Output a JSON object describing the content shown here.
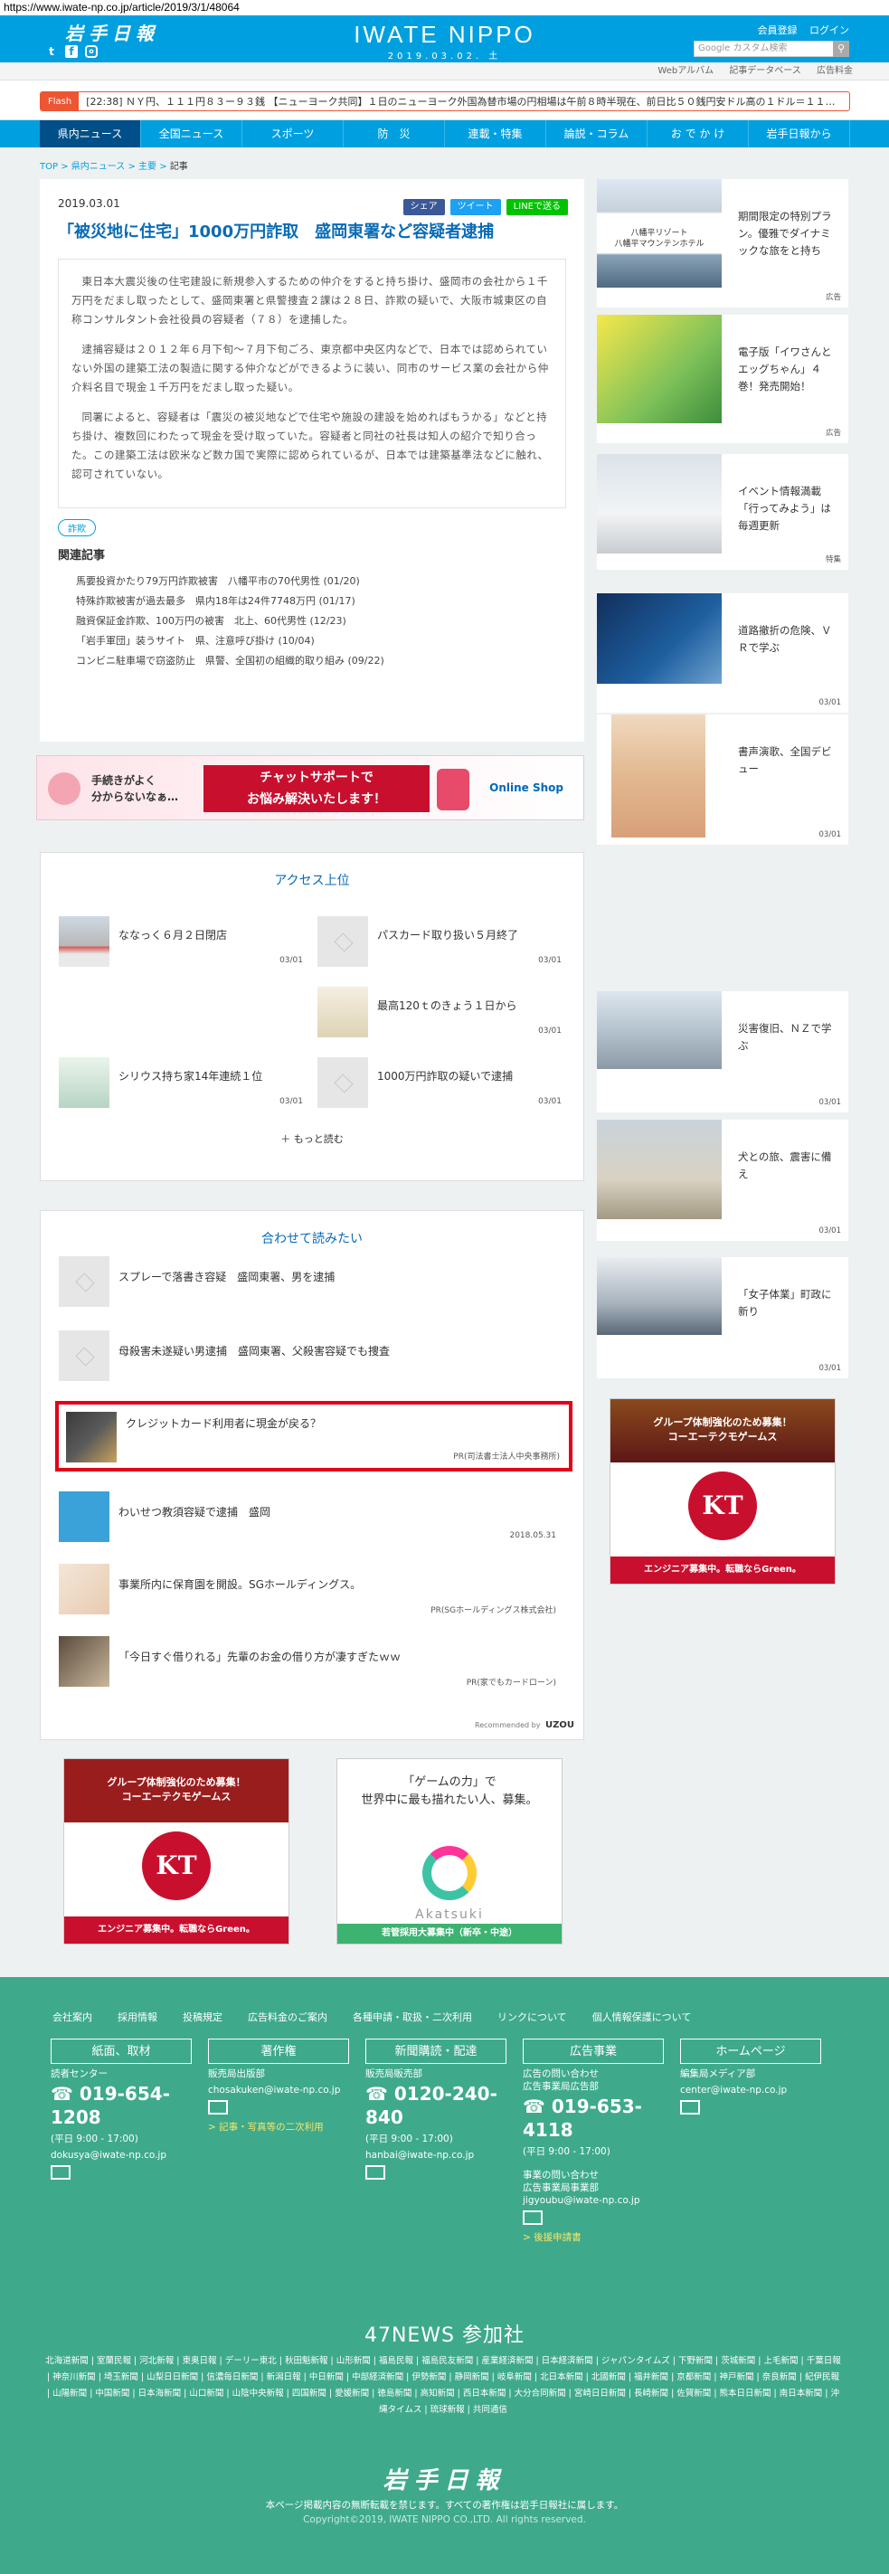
{
  "url": "https://www.iwate-np.co.jp/article/2019/3/1/48064",
  "header": {
    "logo_jp": "岩手日報",
    "brand": "IWATE NIPPO",
    "date": "2019.03.02. 土",
    "register": "会員登録",
    "login": "ログイン",
    "search_placeholder": "Google カスタム検索",
    "social_icons": [
      "twitter-icon",
      "facebook-icon",
      "instagram-icon"
    ]
  },
  "subnav": [
    "Webアルバム",
    "記事データベース",
    "広告料金"
  ],
  "flash": {
    "label": "Flash",
    "text": "[22:38] ＮＹ円、１１１円８３ー９３銭 【ニューヨーク共同】１日のニューヨーク外国為替市場の円相場は午前８時半現在、前日比５０銭円安ドル高の１ドル＝１１…"
  },
  "mainnav": [
    "県内ニュース",
    "全国ニュース",
    "スポーツ",
    "防　災",
    "連載・特集",
    "論説・コラム",
    "お で か け",
    "岩手日報から"
  ],
  "breadcrumb": {
    "top": "TOP",
    "sep": ">",
    "c1": "県内ニュース",
    "c2": "主要",
    "c3": "記事"
  },
  "article": {
    "date": "2019.03.01",
    "share_fb": "シェア",
    "share_tw": "ツイート",
    "share_line": "LINEで送る",
    "title": "「被災地に住宅」1000万円詐取　盛岡東署など容疑者逮捕",
    "paragraphs": [
      "東日本大震災後の住宅建設に新規参入するための仲介をすると持ち掛け、盛岡市の会社から１千万円をだまし取ったとして、盛岡東署と県警捜査２課は２８日、詐欺の疑いで、大阪市城東区の自称コンサルタント会社役員の容疑者（７８）を逮捕した。",
      "逮捕容疑は２０１２年６月下旬～７月下旬ごろ、東京都中央区内などで、日本では認められていない外国の建築工法の製造に関する仲介などができるように装い、同市のサービス業の会社から仲介料名目で現金１千万円をだまし取った疑い。",
      "同署によると、容疑者は「震災の被災地などで住宅や施設の建設を始めればもうかる」などと持ち掛け、複数回にわたって現金を受け取っていた。容疑者と同社の社長は知人の紹介で知り合った。この建築工法は欧米など数カ国で実際に認められているが、日本では建築基準法などに触れ、認可されていない。"
    ],
    "tag": "詐欺",
    "related_title": "関連記事",
    "related": [
      "馬要投資かたり79万円詐欺被害　八幡平市の70代男性 (01/20)",
      "特殊詐欺被害が過去最多　県内18年は24件7748万円 (01/17)",
      "融資保証金詐欺、100万円の被害　北上、60代男性 (12/23)",
      "「岩手軍団」装うサイト　県、注意呼び掛け (10/04)",
      "コンビニ駐車場で窃盗防止　県警、全国初の組織的取り組み (09/22)"
    ]
  },
  "ad_banner": {
    "left": "手続きがよく\n分からないなぁ…",
    "center": "チャットサポートで\nお悩み解決いたします！",
    "right": "Online Shop"
  },
  "access": {
    "title": "アクセス上位",
    "items": [
      {
        "label": "ななっく６月２日閉店",
        "date": "03/01"
      },
      {
        "label": "パスカード取り扱い５月終了",
        "date": "03/01"
      },
      {
        "label": "最高120ｔのきょう１日から",
        "date": "03/01"
      },
      {
        "label": "シリウス持ち家14年連続１位",
        "date": "03/01"
      },
      {
        "label": "1000万円詐取の疑いで逮捕",
        "date": "03/01"
      }
    ],
    "more": "＋ もっと読む"
  },
  "also_read": {
    "title": "合わせて読みたい",
    "items": [
      {
        "label": "スプレーで落書き容疑　盛岡東署、男を逮捕",
        "meta": ""
      },
      {
        "label": "母殺害未遂疑い男逮捕　盛岡東署、父殺害容疑でも捜査",
        "meta": ""
      },
      {
        "label": "クレジットカード利用者に現金が戻る？",
        "meta": "PR(司法書士法人中央事務所)"
      },
      {
        "label": "わいせつ教須容疑で逮捕　盛岡",
        "meta": "2018.05.31"
      },
      {
        "label": "事業所内に保育園を開設。SGホールディングス。",
        "meta": "PR(SGホールディングス株式会社)"
      },
      {
        "label": "「今日すぐ借りれる」先輩のお金の借り方が凄すぎたｗｗ",
        "meta": "PR(家でもカードローン)"
      }
    ],
    "powered": "Recommended by",
    "powered_brand": "UZOU"
  },
  "kt_ad": {
    "top": "グループ体制強化のため募集！\nコーエーテクモゲームス",
    "logo": "KT",
    "bottom": "エンジニア募集中。転職ならGreen。"
  },
  "aka_ad": {
    "title": "「ゲームの力」で\n世界中に最も描れたい人、募集。",
    "name": "Akatsuki",
    "bottom": "若管採用大募集中（新卒・中途）"
  },
  "sidebar": [
    {
      "caption": "八幡平リゾート\n八幡平マウンテンホテル",
      "text": "期間限定の特別プラン。優雅でダイナミックな旅をと持ち",
      "tag": "広告"
    },
    {
      "caption": "",
      "text": "電子版「イワさんとエッグちゃん」４巻！発売開始！",
      "tag": "広告"
    },
    {
      "caption": "",
      "text": "イベント情報満載「行ってみよう」は毎週更新",
      "tag": "特集"
    },
    {
      "caption": "",
      "text": "道路撤折の危険、ＶＲで学ぶ",
      "tag": "03/01"
    },
    {
      "caption": "",
      "text": "書声演歌、全国デビュー",
      "tag": "03/01"
    },
    {
      "caption": "",
      "text": "災害復旧、ＮＺで学ぶ",
      "tag": "03/01"
    },
    {
      "caption": "",
      "text": "犬との旅、震害に備え",
      "tag": "03/01"
    },
    {
      "caption": "",
      "text": "「女子体業」町政に新り",
      "tag": "03/01"
    }
  ],
  "footer": {
    "links": [
      "会社案内",
      "採用情報",
      "投稿規定",
      "広告料金のご案内",
      "各種申請・取扱・二次利用",
      "リンクについて",
      "個人情報保護について"
    ],
    "cols": [
      {
        "btn": "紙面、取材",
        "l1": "読者センター",
        "phone": "019-654-1208",
        "l2": "(平日 9:00 - 17:00)",
        "l3": "dokusya@iwate-np.co.jp",
        "extra": ""
      },
      {
        "btn": "著作権",
        "l1": "販売局出版部",
        "phone": "",
        "l2": "chosakuken@iwate-np.co.jp",
        "l3": "",
        "extra": "> 記事・写真等の二次利用"
      },
      {
        "btn": "新聞購読・配達",
        "l1": "販売局販売部",
        "phone": "0120-240-840",
        "l2": "(平日 9:00 - 17:00)",
        "l3": "hanbai@iwate-np.co.jp",
        "extra": ""
      },
      {
        "btn": "広告事業",
        "l1": "広告の問い合わせ\n広告事業局広告部",
        "phone": "019-653-4118",
        "l2": "(平日 9:00 - 17:00)",
        "l3": "事業の問い合わせ\n広告事業局事業部\njigyoubu@iwate-np.co.jp",
        "extra": "> 後援申請書"
      },
      {
        "btn": "ホームページ",
        "l1": "編集局メディア部",
        "phone": "",
        "l2": "center@iwate-np.co.jp",
        "l3": "",
        "extra": ""
      }
    ],
    "news47": "47NEWS 参加社",
    "papers": "北海道新聞 | 室蘭民報 | 河北新報 | 東奥日報 | デーリー東北 | 秋田魁新報 | 山形新聞 | 福島民報 | 福島民友新聞 | 産業経済新聞 | 日本経済新聞 | ジャパンタイムズ | 下野新聞 | 茨城新聞 | 上毛新聞 | 千葉日報 | 神奈川新聞 | 埼玉新聞 | 山梨日日新聞 | 信濃毎日新聞 | 新潟日報 | 中日新聞 | 中部経済新聞 | 伊勢新聞 | 静岡新聞 | 岐阜新聞 | 北日本新聞 | 北國新聞 | 福井新聞 | 京都新聞 | 神戸新聞 | 奈良新聞 | 紀伊民報 | 山陽新聞 | 中国新聞 | 日本海新聞 | 山口新聞 | 山陰中央新報 | 四国新聞 | 愛媛新聞 | 徳島新聞 | 高知新聞 | 西日本新聞 | 大分合同新聞 | 宮崎日日新聞 | 長崎新聞 | 佐賀新聞 | 熊本日日新聞 | 南日本新聞 | 沖縄タイムス | 琉球新報 | 共同通信",
    "logo": "岩手日報",
    "notice": "本ページ掲載内容の無断転載を禁じます。すべての著作権は岩手日報社に属します。",
    "copyright": "Copyright©2019, IWATE NIPPO CO.,LTD. All rights reserved."
  }
}
